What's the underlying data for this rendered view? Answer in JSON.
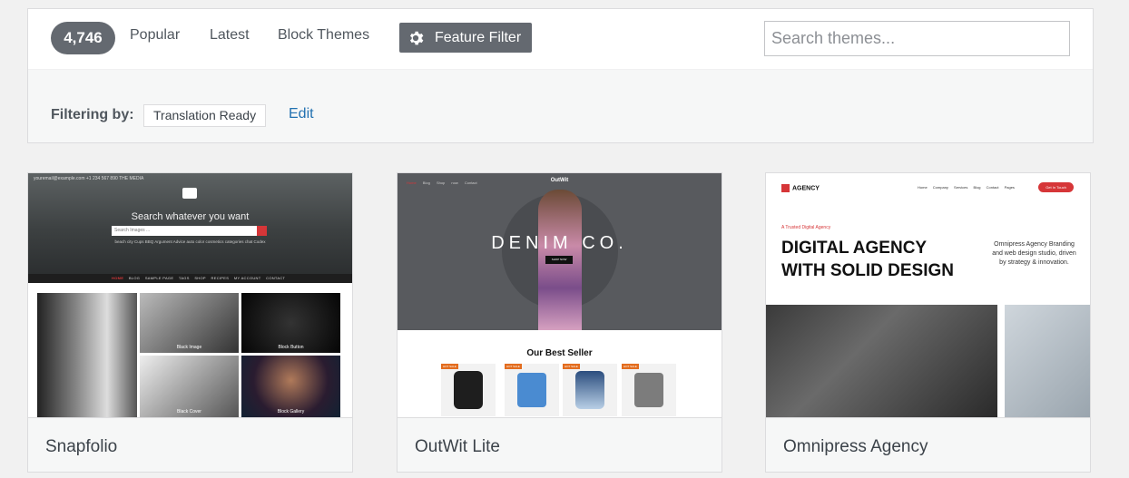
{
  "filter_bar": {
    "count": "4,746",
    "tabs": [
      "Popular",
      "Latest",
      "Block Themes"
    ],
    "feature_filter_label": "Feature Filter",
    "search_placeholder": "Search themes..."
  },
  "filtering": {
    "label": "Filtering by:",
    "tag": "Translation Ready",
    "edit_label": "Edit"
  },
  "themes": [
    {
      "name": "Snapfolio",
      "preview": {
        "topbar": "youremail@example.com   +1 234 567 890   THE MEDIA",
        "title": "Search whatever you want",
        "search_placeholder": "Search Images ...",
        "tags": "beach  city  Cups  BBQ  Argument  Advice  auto  color  cosmetics  categories  chat  Codex",
        "nav": [
          "HOME",
          "BLOG",
          "SAMPLE PAGE",
          "TAGS",
          "SHOP",
          "RECIPES",
          "MY ACCOUNT",
          "CONTACT"
        ],
        "tiles": [
          "Black Image",
          "Block Button",
          "Black Cover",
          "Block Gallery"
        ]
      }
    },
    {
      "name": "OutWit Lite",
      "preview": {
        "nav": [
          "Home",
          "Blog",
          "Shop now",
          "Contact"
        ],
        "logo": "OutWit",
        "hero_text": "DENIM CO.",
        "hero_button": "SHOP NOW",
        "section_title": "Our Best Seller",
        "badges": [
          "HOT SALE",
          "HOT SALE",
          "HOT SALE",
          "HOT SALE"
        ]
      }
    },
    {
      "name": "Omnipress Agency",
      "preview": {
        "logo": "AGENCY",
        "menu": [
          "Home",
          "Company",
          "Services",
          "Blog",
          "Contact",
          "Pages"
        ],
        "cta": "Get In Touch",
        "kicker": "A Trusted Digital Agency",
        "headline_1": "DIGITAL AGENCY",
        "headline_2": "WITH SOLID DESIGN",
        "sub": "Omnipress Agency Branding and web design studio, driven by strategy & innovation."
      }
    }
  ],
  "colors": {
    "page_bg": "#f1f1f1",
    "button_gray": "#646970",
    "link_blue": "#2271b1",
    "accent_red": "#d63638"
  }
}
